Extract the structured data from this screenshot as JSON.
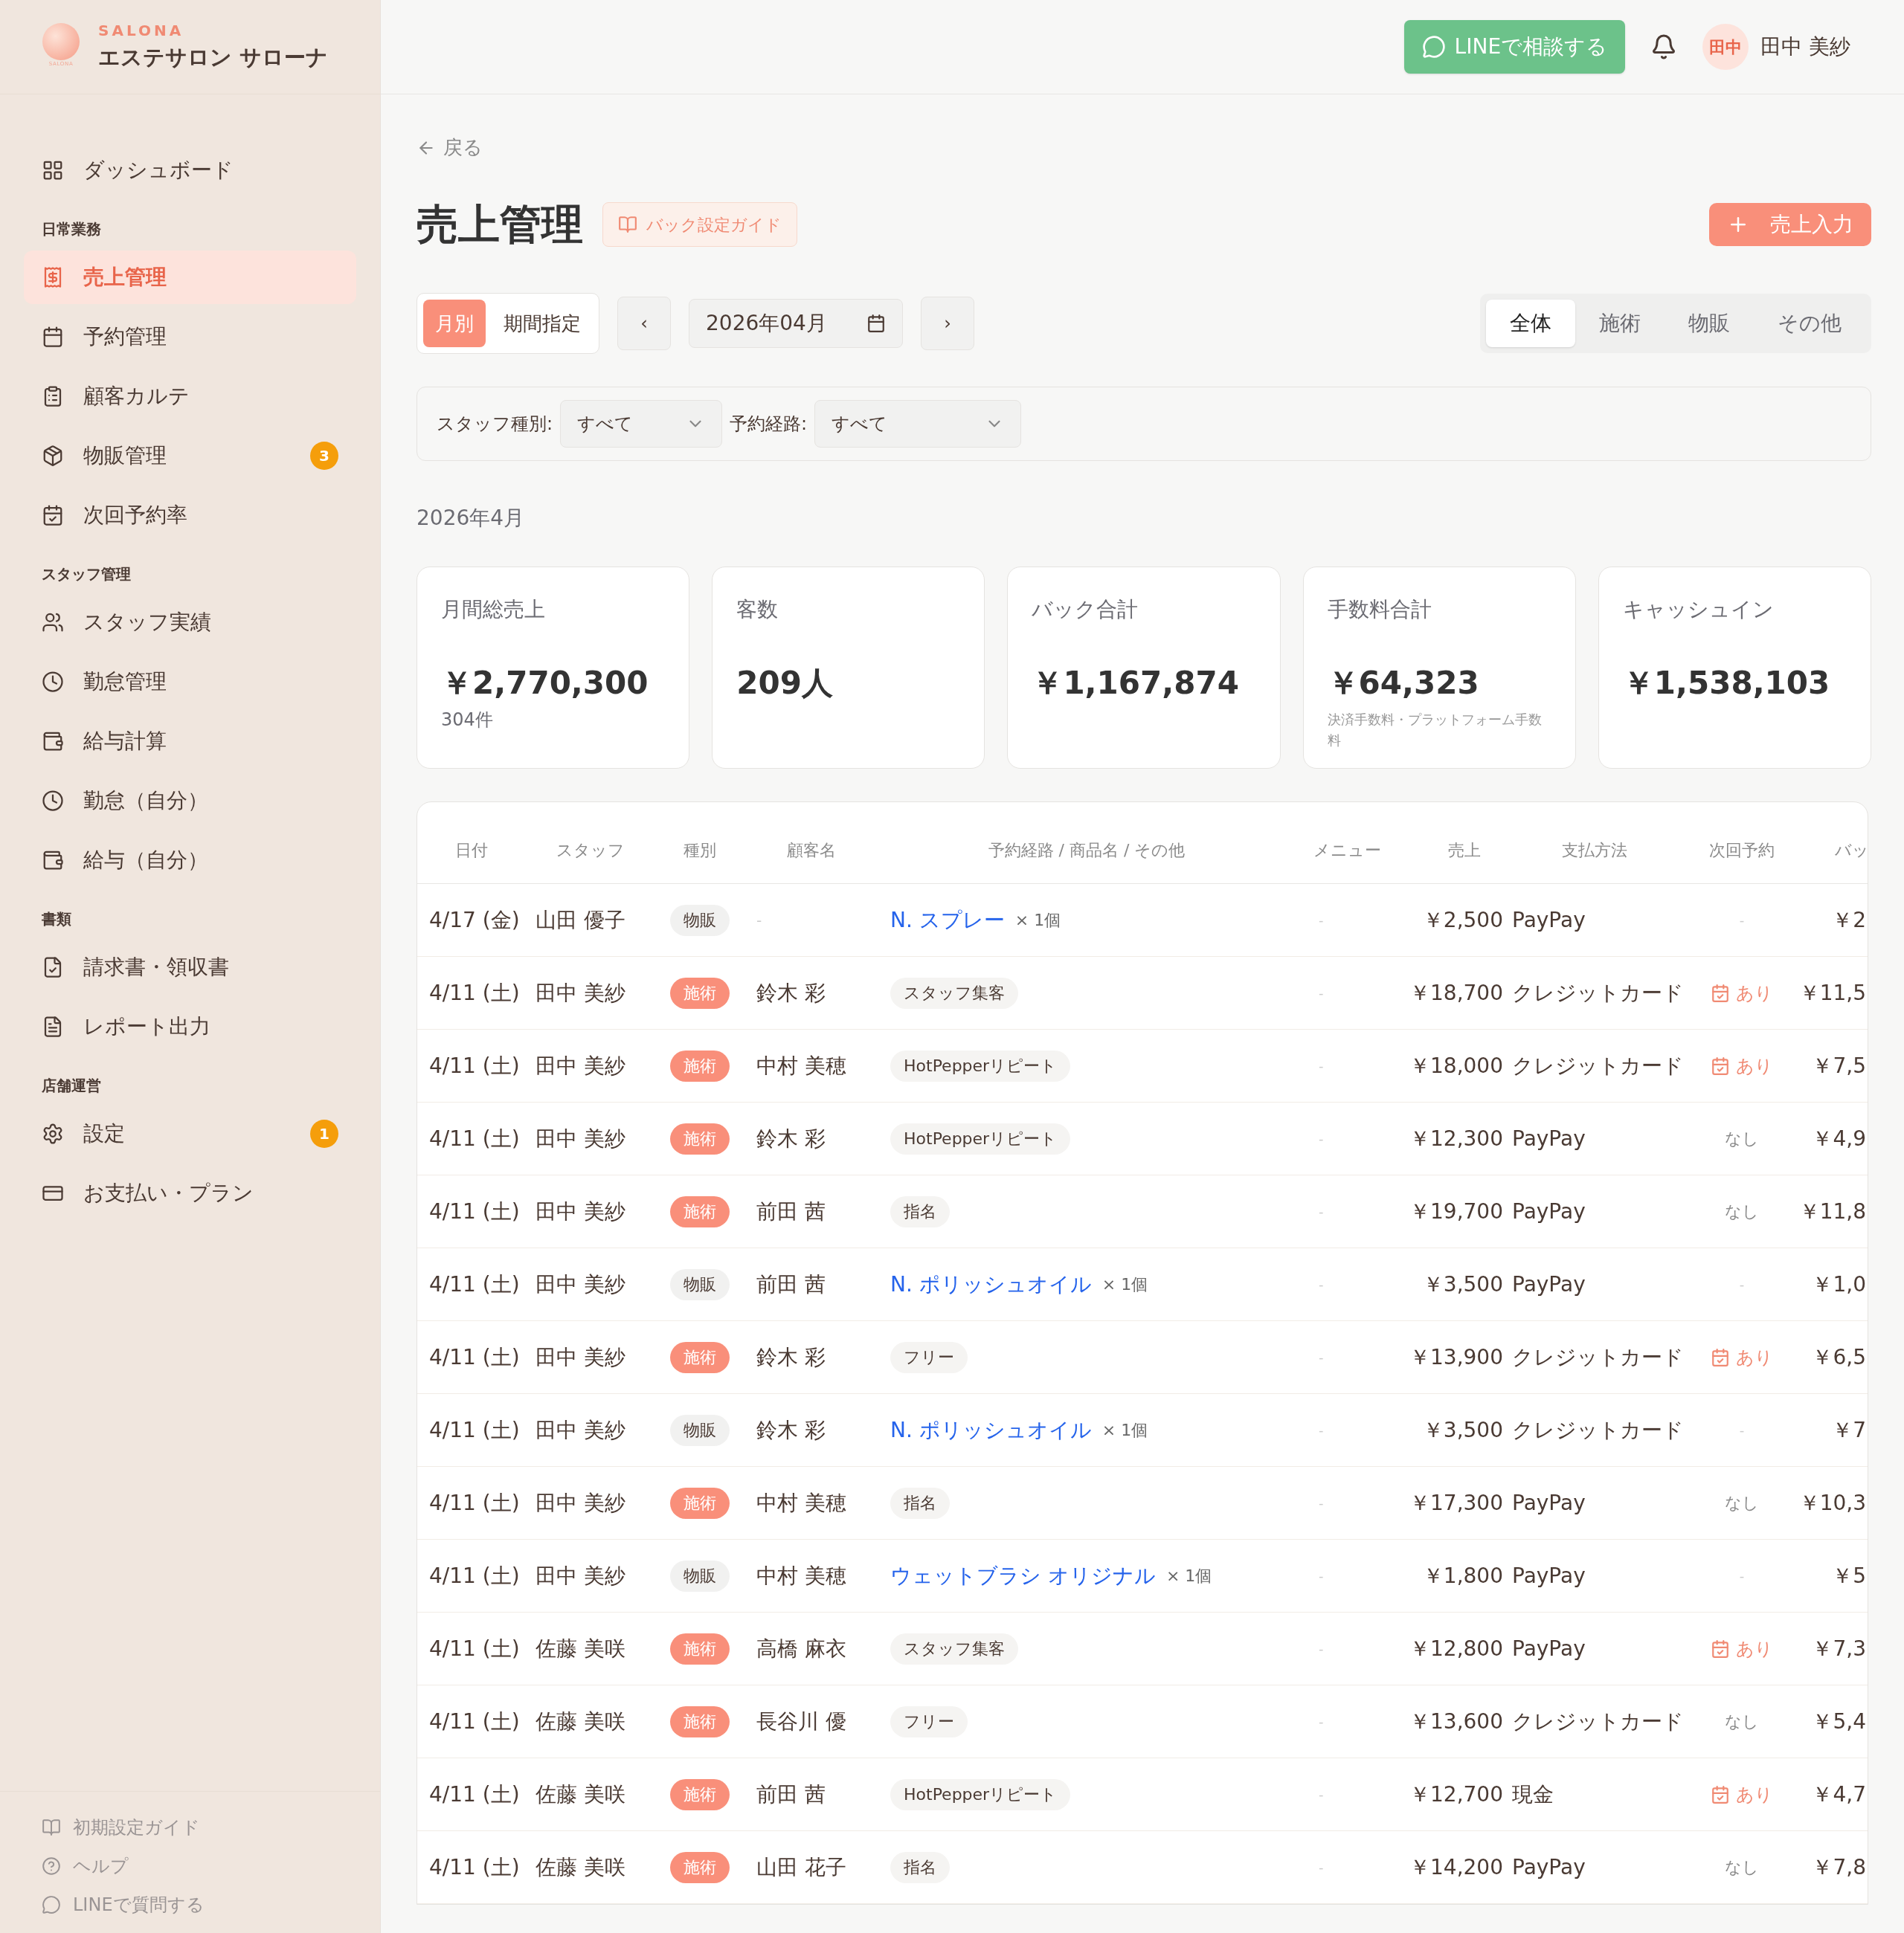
{
  "brand": {
    "tag": "SALONA",
    "logo_text": "SALONA",
    "name": "エステサロン サローナ"
  },
  "sidebar": {
    "sections": [
      {
        "items": [
          {
            "label": "ダッシュボード",
            "selected": false
          }
        ]
      },
      {
        "label": "日常業務",
        "items": [
          {
            "label": "売上管理",
            "selected": true
          },
          {
            "label": "予約管理",
            "selected": false
          },
          {
            "label": "顧客カルテ",
            "selected": false
          },
          {
            "label": "物販管理",
            "selected": false,
            "badge": "3"
          },
          {
            "label": "次回予約率",
            "selected": false
          }
        ]
      },
      {
        "label": "スタッフ管理",
        "items": [
          {
            "label": "スタッフ実績",
            "selected": false
          },
          {
            "label": "勤怠管理",
            "selected": false
          },
          {
            "label": "給与計算",
            "selected": false
          },
          {
            "label": "勤怠（自分）",
            "selected": false
          },
          {
            "label": "給与（自分）",
            "selected": false
          }
        ]
      },
      {
        "label": "書類",
        "items": [
          {
            "label": "請求書・領収書",
            "selected": false
          },
          {
            "label": "レポート出力",
            "selected": false
          }
        ]
      },
      {
        "label": "店舗運営",
        "items": [
          {
            "label": "設定",
            "selected": false,
            "badge": "1"
          },
          {
            "label": "お支払い・プラン",
            "selected": false
          }
        ]
      }
    ],
    "footer": [
      {
        "label": "初期設定ガイド"
      },
      {
        "label": "ヘルプ"
      },
      {
        "label": "LINEで質問する"
      }
    ]
  },
  "header": {
    "line_button": "LINEで相談する",
    "avatar": "田中",
    "user": "田中 美紗"
  },
  "back": "戻る",
  "title": "売上管理",
  "guide_button": "バック設定ガイド",
  "add_button": "売上入力",
  "mode_tabs": [
    {
      "label": "月別",
      "selected": true
    },
    {
      "label": "期間指定",
      "selected": false
    }
  ],
  "prev": "‹",
  "next": "›",
  "month_value": "2026年04月",
  "type_tabs": [
    {
      "label": "全体",
      "selected": true
    },
    {
      "label": "施術",
      "selected": false
    },
    {
      "label": "物販",
      "selected": false
    },
    {
      "label": "その他",
      "selected": false
    }
  ],
  "filters": [
    {
      "label": "スタッフ種別:",
      "value": "すべて"
    },
    {
      "label": "予約経路:",
      "value": "すべて"
    }
  ],
  "period": "2026年4月",
  "cards": [
    {
      "label": "月間総売上",
      "value": "￥2,770,300",
      "sub": "304件"
    },
    {
      "label": "客数",
      "value": "209人"
    },
    {
      "label": "バック合計",
      "value": "￥1,167,874"
    },
    {
      "label": "手数料合計",
      "value": "￥64,323",
      "note": "決済手数料・プラットフォーム手数料"
    },
    {
      "label": "キャッシュイン",
      "value": "￥1,538,103"
    }
  ],
  "table": {
    "columns": [
      "日付",
      "スタッフ",
      "種別",
      "顧客名",
      "予約経路 / 商品名 / その他",
      "メニュー",
      "売上",
      "支払方法",
      "次回予約",
      "バッ"
    ],
    "rows": [
      {
        "date": "4/17 (金)",
        "staff": "山田 優子",
        "type": {
          "kind": "product",
          "label": "物販"
        },
        "customer": "-",
        "route": {
          "kind": "product",
          "name": "N. スプレー",
          "qty": "× 1個"
        },
        "menu": "-",
        "sales": "￥2,500",
        "pay": "PayPay",
        "next": {
          "kind": "none",
          "label": "-"
        },
        "back": "￥2"
      },
      {
        "date": "4/11 (土)",
        "staff": "田中 美紗",
        "type": {
          "kind": "service",
          "label": "施術"
        },
        "customer": "鈴木 彩",
        "route": {
          "kind": "tag",
          "name": "スタッフ集客"
        },
        "menu": "-",
        "sales": "￥18,700",
        "pay": "クレジットカード",
        "next": {
          "kind": "yes",
          "label": "あり"
        },
        "back": "￥11,5"
      },
      {
        "date": "4/11 (土)",
        "staff": "田中 美紗",
        "type": {
          "kind": "service",
          "label": "施術"
        },
        "customer": "中村 美穂",
        "route": {
          "kind": "tag",
          "name": "HotPepperリピート"
        },
        "menu": "-",
        "sales": "￥18,000",
        "pay": "クレジットカード",
        "next": {
          "kind": "yes",
          "label": "あり"
        },
        "back": "￥7,5"
      },
      {
        "date": "4/11 (土)",
        "staff": "田中 美紗",
        "type": {
          "kind": "service",
          "label": "施術"
        },
        "customer": "鈴木 彩",
        "route": {
          "kind": "tag",
          "name": "HotPepperリピート"
        },
        "menu": "-",
        "sales": "￥12,300",
        "pay": "PayPay",
        "next": {
          "kind": "no",
          "label": "なし"
        },
        "back": "￥4,9"
      },
      {
        "date": "4/11 (土)",
        "staff": "田中 美紗",
        "type": {
          "kind": "service",
          "label": "施術"
        },
        "customer": "前田 茜",
        "route": {
          "kind": "tag",
          "name": "指名"
        },
        "menu": "-",
        "sales": "￥19,700",
        "pay": "PayPay",
        "next": {
          "kind": "no",
          "label": "なし"
        },
        "back": "￥11,8"
      },
      {
        "date": "4/11 (土)",
        "staff": "田中 美紗",
        "type": {
          "kind": "product",
          "label": "物販"
        },
        "customer": "前田 茜",
        "route": {
          "kind": "product",
          "name": "N. ポリッシュオイル",
          "qty": "× 1個"
        },
        "menu": "-",
        "sales": "￥3,500",
        "pay": "PayPay",
        "next": {
          "kind": "none",
          "label": "-"
        },
        "back": "￥1,0"
      },
      {
        "date": "4/11 (土)",
        "staff": "田中 美紗",
        "type": {
          "kind": "service",
          "label": "施術"
        },
        "customer": "鈴木 彩",
        "route": {
          "kind": "tag",
          "name": "フリー"
        },
        "menu": "-",
        "sales": "￥13,900",
        "pay": "クレジットカード",
        "next": {
          "kind": "yes",
          "label": "あり"
        },
        "back": "￥6,5"
      },
      {
        "date": "4/11 (土)",
        "staff": "田中 美紗",
        "type": {
          "kind": "product",
          "label": "物販"
        },
        "customer": "鈴木 彩",
        "route": {
          "kind": "product",
          "name": "N. ポリッシュオイル",
          "qty": "× 1個"
        },
        "menu": "-",
        "sales": "￥3,500",
        "pay": "クレジットカード",
        "next": {
          "kind": "none",
          "label": "-"
        },
        "back": "￥7"
      },
      {
        "date": "4/11 (土)",
        "staff": "田中 美紗",
        "type": {
          "kind": "service",
          "label": "施術"
        },
        "customer": "中村 美穂",
        "route": {
          "kind": "tag",
          "name": "指名"
        },
        "menu": "-",
        "sales": "￥17,300",
        "pay": "PayPay",
        "next": {
          "kind": "no",
          "label": "なし"
        },
        "back": "￥10,3"
      },
      {
        "date": "4/11 (土)",
        "staff": "田中 美紗",
        "type": {
          "kind": "product",
          "label": "物販"
        },
        "customer": "中村 美穂",
        "route": {
          "kind": "product",
          "name": "ウェットブラシ オリジナル",
          "qty": "× 1個"
        },
        "menu": "-",
        "sales": "￥1,800",
        "pay": "PayPay",
        "next": {
          "kind": "none",
          "label": "-"
        },
        "back": "￥5"
      },
      {
        "date": "4/11 (土)",
        "staff": "佐藤 美咲",
        "type": {
          "kind": "service",
          "label": "施術"
        },
        "customer": "高橋 麻衣",
        "route": {
          "kind": "tag",
          "name": "スタッフ集客"
        },
        "menu": "-",
        "sales": "￥12,800",
        "pay": "PayPay",
        "next": {
          "kind": "yes",
          "label": "あり"
        },
        "back": "￥7,3"
      },
      {
        "date": "4/11 (土)",
        "staff": "佐藤 美咲",
        "type": {
          "kind": "service",
          "label": "施術"
        },
        "customer": "長谷川 優",
        "route": {
          "kind": "tag",
          "name": "フリー"
        },
        "menu": "-",
        "sales": "￥13,600",
        "pay": "クレジットカード",
        "next": {
          "kind": "no",
          "label": "なし"
        },
        "back": "￥5,4"
      },
      {
        "date": "4/11 (土)",
        "staff": "佐藤 美咲",
        "type": {
          "kind": "service",
          "label": "施術"
        },
        "customer": "前田 茜",
        "route": {
          "kind": "tag",
          "name": "HotPepperリピート"
        },
        "menu": "-",
        "sales": "￥12,700",
        "pay": "現金",
        "next": {
          "kind": "yes",
          "label": "あり"
        },
        "back": "￥4,7"
      },
      {
        "date": "4/11 (土)",
        "staff": "佐藤 美咲",
        "type": {
          "kind": "service",
          "label": "施術"
        },
        "customer": "山田 花子",
        "route": {
          "kind": "tag",
          "name": "指名"
        },
        "menu": "-",
        "sales": "￥14,200",
        "pay": "PayPay",
        "next": {
          "kind": "no",
          "label": "なし"
        },
        "back": "￥7,8"
      }
    ]
  }
}
